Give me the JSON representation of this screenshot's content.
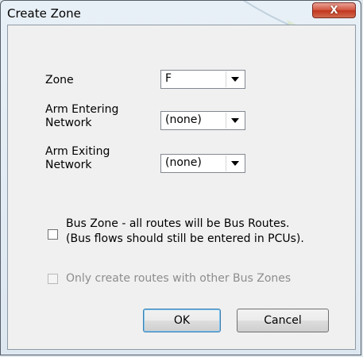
{
  "window": {
    "title": "Create Zone",
    "close_glyph": "X"
  },
  "form": {
    "zone": {
      "label": "Zone",
      "value": "F"
    },
    "arm_entering": {
      "label_line1": "Arm Entering",
      "label_line2": "Network",
      "value": "(none)"
    },
    "arm_exiting": {
      "label_line1": "Arm Exiting",
      "label_line2": "Network",
      "value": "(none)"
    },
    "bus_zone": {
      "line1": "Bus Zone - all routes will be Bus Routes.",
      "line2": "(Bus flows should still be entered in PCUs).",
      "checked": false
    },
    "only_bus_zones": {
      "label": "Only create routes with other Bus Zones",
      "checked": false,
      "enabled": false
    }
  },
  "buttons": {
    "ok": "OK",
    "cancel": "Cancel"
  },
  "colors": {
    "close_button": "#c7432c",
    "disabled_text": "#8d8d8d",
    "client_bg": "#f0f0f0"
  }
}
